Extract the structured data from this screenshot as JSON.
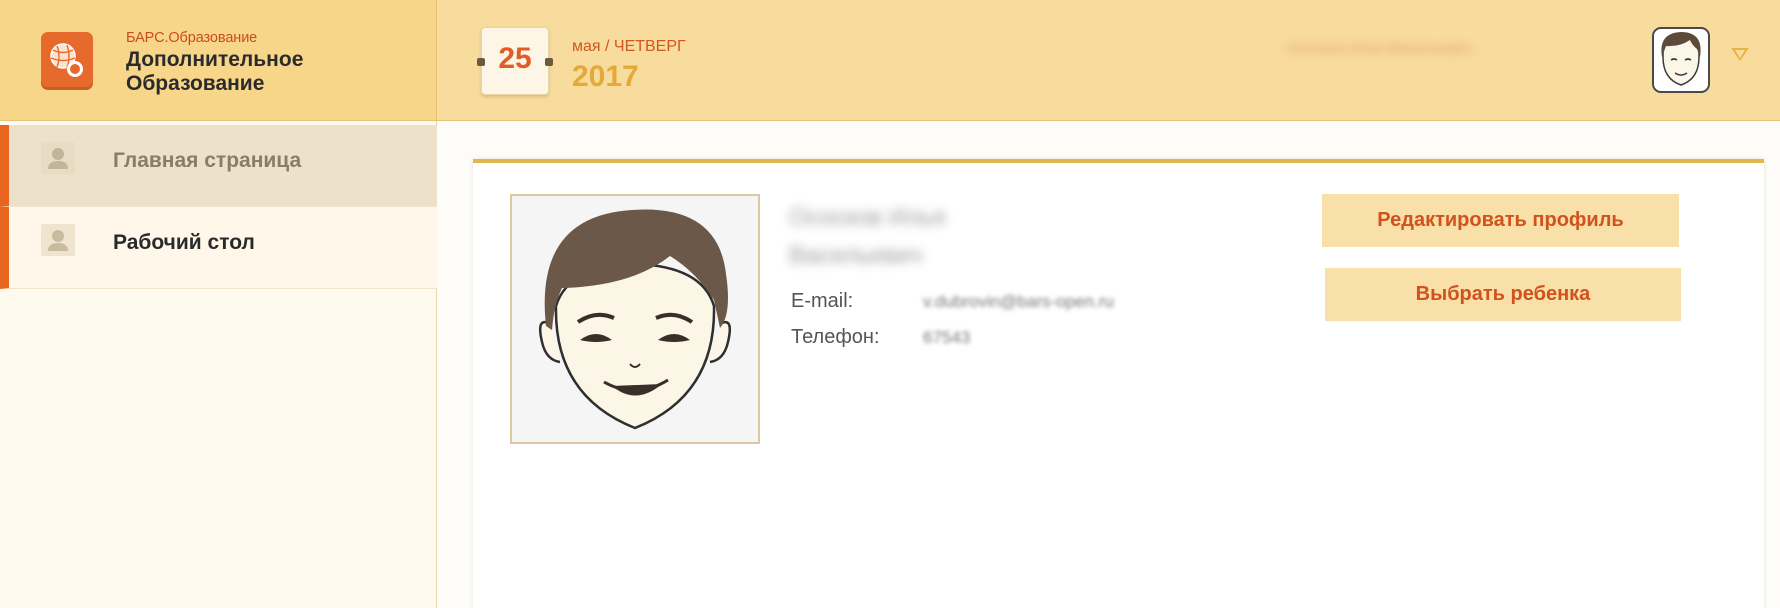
{
  "brand": {
    "small": "БАРС.Образование",
    "title_line1": "Дополнительное",
    "title_line2": "Образование"
  },
  "header": {
    "day": "25",
    "month_weekday": "мая / ЧЕТВЕРГ",
    "year": "2017",
    "user_name": "Ососков Илья Васильевич"
  },
  "sidebar": {
    "items": [
      {
        "label": "Главная страница",
        "active": true
      },
      {
        "label": "Рабочий стол",
        "active": false
      }
    ]
  },
  "profile": {
    "name_line1": "Ососков Илья",
    "name_line2": "Васильевич",
    "email_label": "E-mail:",
    "email_value": "v.dubrovin@bars-open.ru",
    "phone_label": "Телефон:",
    "phone_value": "67543",
    "edit_button": "Редактировать профиль",
    "child_button": "Выбрать ребенка"
  },
  "colors": {
    "accent_orange": "#e8651e",
    "header_bg": "#f8dc9d",
    "button_bg": "#f9dfa8",
    "year_color": "#e5a93a"
  },
  "icons": [
    "basketball-logo-icon",
    "user-silhouette-icon",
    "avatar-face-icon",
    "dropdown-caret-icon"
  ]
}
